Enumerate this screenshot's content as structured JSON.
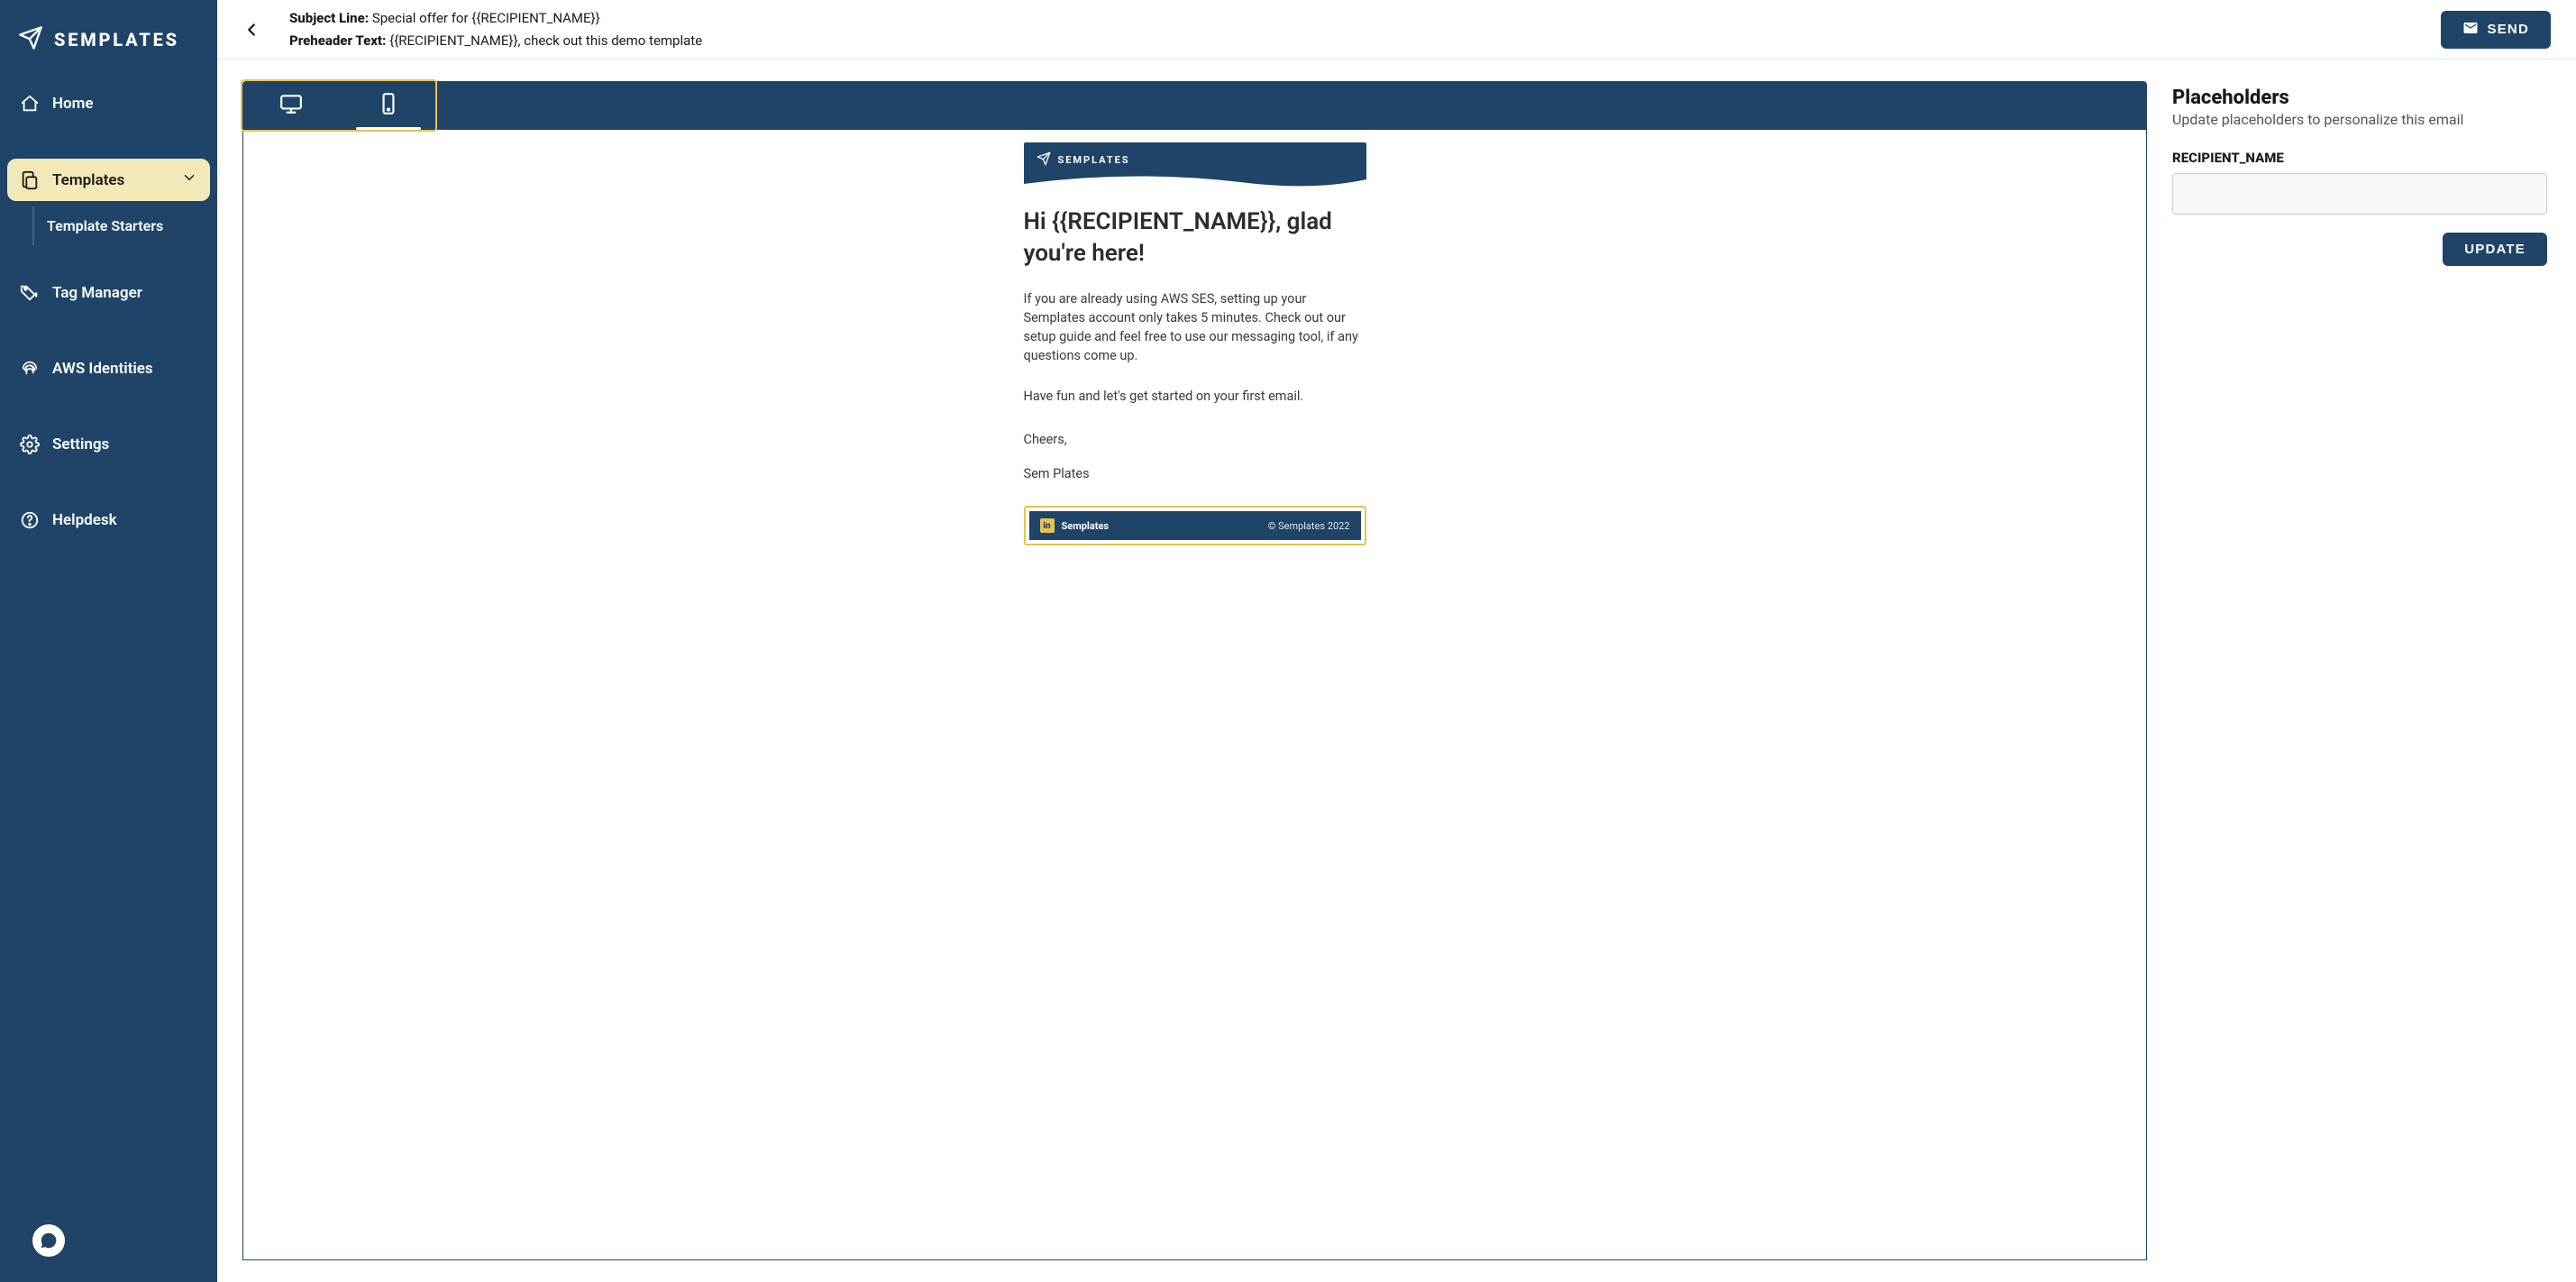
{
  "brand": "SEMPLATES",
  "sidebar": {
    "items": [
      {
        "label": "Home"
      },
      {
        "label": "Templates"
      },
      {
        "label": "Tag Manager"
      },
      {
        "label": "AWS Identities"
      },
      {
        "label": "Settings"
      },
      {
        "label": "Helpdesk"
      }
    ],
    "sub": {
      "template_starters": "Template Starters"
    }
  },
  "header": {
    "subject_label": "Subject Line: ",
    "subject_value": "Special offer for {{RECIPIENT_NAME}}",
    "preheader_label": "Preheader Text: ",
    "preheader_value": "{{RECIPIENT_NAME}}, check out this demo template",
    "send_label": "SEND"
  },
  "email": {
    "brand_sm": "SEMPLATES",
    "h1": "Hi {{RECIPIENT_NAME}}, glad you're here!",
    "p1": "If you are already using AWS SES, setting up your Semplates account only takes 5 minutes. Check out our setup guide and feel free to use our messaging tool, if any questions come up.",
    "p2": "Have fun and let's get started on your first email.",
    "cheers": "Cheers,",
    "sign": "Sem Plates",
    "footer_left": "Semplates",
    "footer_right": "© Semplates 2022"
  },
  "panel": {
    "title": "Placeholders",
    "subtitle": "Update placeholders to personalize this email",
    "field_label": "RECIPIENT_NAME",
    "field_value": "",
    "update_label": "UPDATE"
  }
}
